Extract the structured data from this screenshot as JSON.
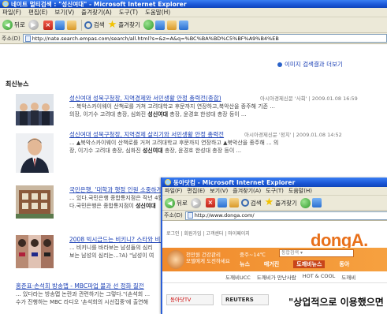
{
  "main_window": {
    "title": "네이트 멀티검색 : \"성신여대\" - Microsoft Internet Explorer",
    "menu": [
      "파일(F)",
      "편집(E)",
      "보기(V)",
      "즐겨찾기(A)",
      "도구(T)",
      "도움말(H)"
    ],
    "toolbar": {
      "back": "뒤로",
      "search": "검색",
      "favorites": "즐겨찾기"
    },
    "address_label": "주소(D)",
    "address_url": "http://nate.search.empas.com/search/all.html?s=&z=A&q=%BC%BA%BD%C5%BF%A9%B4%EB"
  },
  "content": {
    "more_link": "이미지 검색결과 더보기",
    "section_title": "최신뉴스",
    "news": [
      {
        "headline": "성신여대 성북구청장, 지역경제와 서민생활 안정 총력전(종합)",
        "source": "아시아경제신문 '사회' | 2009.01.08 16:59",
        "line1": "... 북악스카이웨이 산책로를 거쳐 고려대학교 후문까지 연장하고,북악산을 종주해 기존 ...",
        "line2_pre": "의장, 이기수 고려대 총장, 심화진 ",
        "line2_bold": "성신여대",
        "line2_post": " 총장, 윤경호 한성대 총장 등이 ..."
      },
      {
        "headline": "성신여대 성북구청장, 지역경제 살리기와 서민생활 안정 총력전",
        "source": "아시아경제신문 '정치' | 2009.01.08 14:52",
        "line1": "... ▲북악스카이웨이 산책로를 거쳐 고려대학교 후문까지 연장하고 ▲북악산을 종주해 ... 의",
        "line2_pre": "장, 이기수 고려대 총장, 심화진 ",
        "line2_bold": "성신여대",
        "line2_post": " 총장, 윤경호 한성대 총장 등이 ..."
      },
      {
        "headline": "국민은행, '대학과 행정 인원 소중하게'",
        "source": "",
        "line1": "... 있다.국민은행 종합통지점은 작년 4월",
        "line2_pre": "다.국민은행은 종합통지점이 ",
        "line2_bold": "성신여대",
        "line2_post": ""
      },
      {
        "headline": "2008 빅시급드는 비키니? 스타와 비키",
        "source": "",
        "line1": "... 비키니를 바라보는 남성들의 심리",
        "line2_pre": "보는 남성의 심리는...?A) \"남성이 여",
        "line2_bold": "",
        "line2_post": ""
      },
      {
        "headline": "홍준표·손석희 방송맵 - MBC파업 불과 선 정화 질전",
        "source": "",
        "line1": "... 있다라는 방송맵 논란과 관련하기는 그렇다.\"(손석희 ...",
        "line2_pre": "수가 진행하는 MBC 라디오 '손석희의 시선집중'에 출연해",
        "line2_bold": "",
        "line2_post": ""
      }
    ]
  },
  "donga_window": {
    "title": "동아닷컴 - Microsoft Internet Explorer",
    "menu": [
      "파일(F)",
      "편집(E)",
      "보기(V)",
      "즐겨찾기(A)",
      "도구(T)",
      "도움말(H)"
    ],
    "toolbar": {
      "back": "뒤로",
      "search": "검색",
      "favorites": "즐겨찾기"
    },
    "address_label": "주소(D)",
    "address_url": "http://www.donga.com/",
    "top_links": "로그인 | 회원가입 | 고객센터 | 마이페이지",
    "logo": "dongA.",
    "promo_line1": "천만원 건강관리",
    "promo_line2": "모델에게 도전하세요",
    "weather": "중주~14℃",
    "search_placeholder": "통합검색 ▾",
    "nav": [
      "뉴스",
      "매거진",
      "도깨비뉴스",
      "동아"
    ],
    "nav_active": 2,
    "subnav": [
      "도깨비UCC",
      "도깨비가 만난사람",
      "HOT & COOL",
      "도깨비"
    ],
    "tv_label": "동아닷TV",
    "reuters_label": "REUTERS",
    "quote": "\"상업적으로 이용했으면"
  }
}
